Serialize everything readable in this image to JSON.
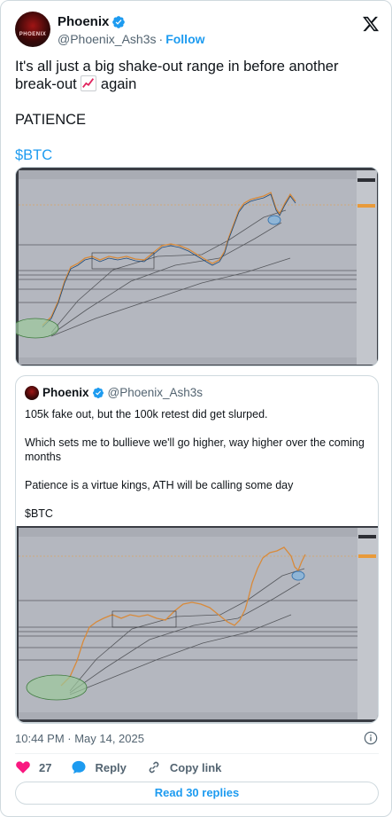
{
  "author": {
    "name": "Phoenix",
    "handle": "@Phoenix_Ash3s",
    "separator": "·",
    "follow_label": "Follow",
    "avatar_text": "PHOENIX"
  },
  "tweet": {
    "line1": "It's all just a big shake-out range in before another break-out",
    "line1_tail": "again",
    "line2": "PATIENCE",
    "cashtag": "$BTC"
  },
  "quote": {
    "name": "Phoenix",
    "handle": "@Phoenix_Ash3s",
    "p1": "105k fake out, but the 100k retest did get slurped.",
    "p2": "Which sets me to bullieve we'll go higher, way higher over the coming months",
    "p3": "Patience is a virtue kings, ATH will be calling some day",
    "p4": "$BTC"
  },
  "footer": {
    "timestamp": "10:44 PM · May 14, 2025",
    "like_count": "27",
    "reply_label": "Reply",
    "copy_link_label": "Copy link",
    "read_replies_label": "Read 30 replies"
  },
  "colors": {
    "accent": "#1d9bf0",
    "like": "#f91880",
    "chart_bg": "#b4b7bf"
  },
  "icons": {
    "verified": "verified-badge-icon",
    "x_logo": "x-logo-icon",
    "emoji": "chart-increasing-emoji",
    "info": "info-icon",
    "heart": "heart-icon",
    "reply": "reply-bubble-icon",
    "link": "link-icon"
  }
}
